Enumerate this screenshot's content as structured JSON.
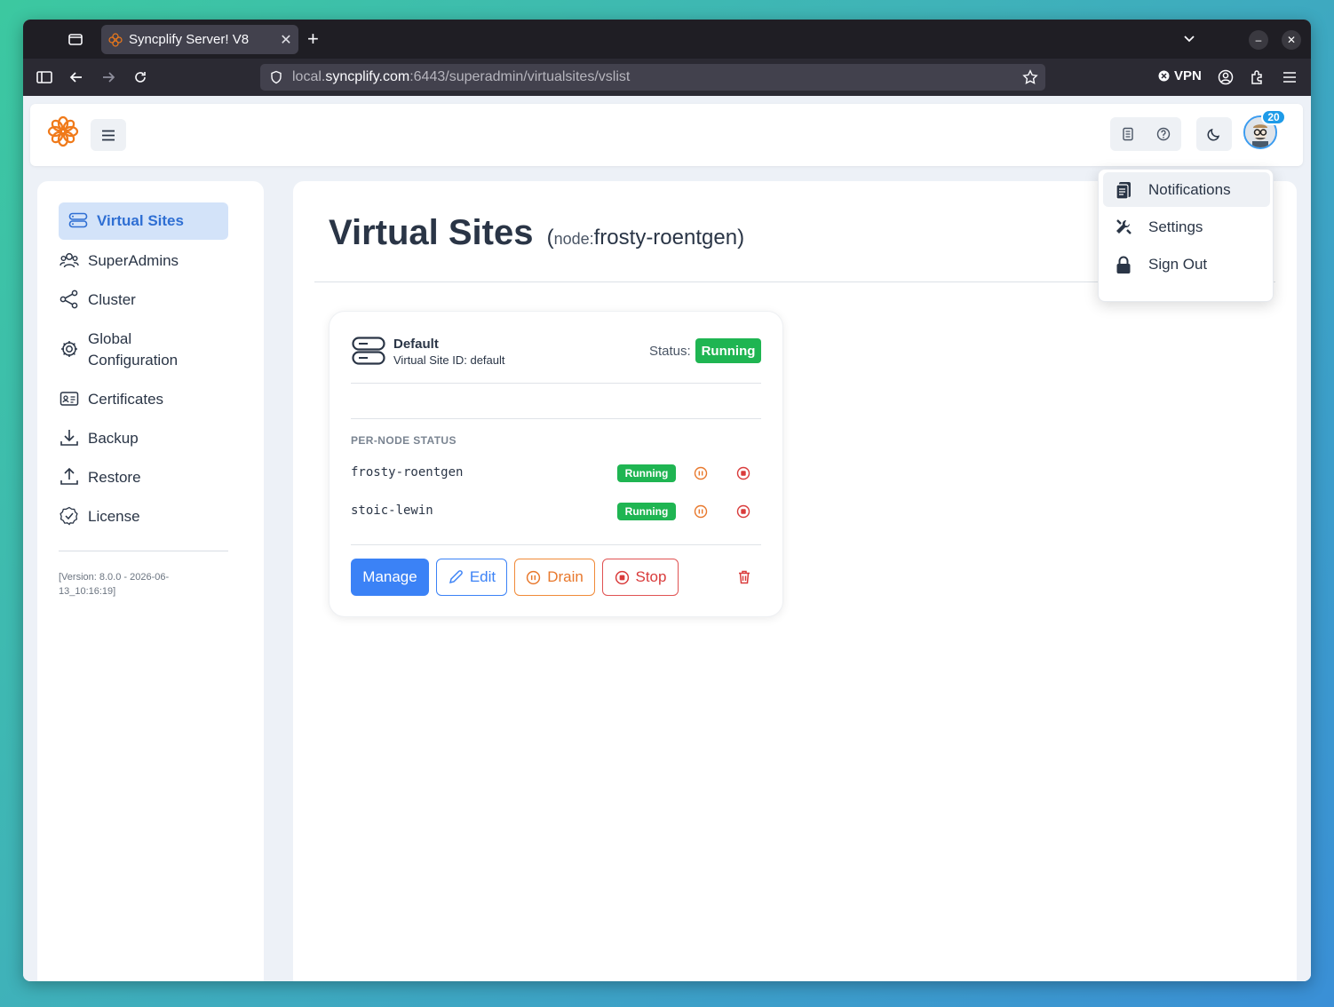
{
  "browser": {
    "tab_title": "Syncplify Server! V8",
    "tab_close": "✕",
    "new_tab": "+",
    "url_prefix": "local.",
    "url_domain": "syncplify.com",
    "url_rest": ":6443/superadmin/virtualsites/vslist",
    "vpn_label": "VPN"
  },
  "header": {
    "notification_count": "20"
  },
  "sidebar": {
    "items": [
      {
        "label": "Virtual Sites",
        "icon": "server-icon"
      },
      {
        "label": "SuperAdmins",
        "icon": "users-icon"
      },
      {
        "label": "Cluster",
        "icon": "share-icon"
      },
      {
        "label": "Global Configuration",
        "icon": "gear-icon"
      },
      {
        "label": "Certificates",
        "icon": "id-card-icon"
      },
      {
        "label": "Backup",
        "icon": "download-icon"
      },
      {
        "label": "Restore",
        "icon": "upload-icon"
      },
      {
        "label": "License",
        "icon": "badge-check-icon"
      }
    ],
    "global_config_line1": "Global",
    "global_config_line2": "Configuration",
    "version": "[Version: 8.0.0 - 2026-06-13_10:16:19]"
  },
  "main": {
    "title": "Virtual Sites",
    "subtitle_open": "(",
    "subtitle_node_kw": "node:",
    "subtitle_node": "frosty-roentgen",
    "subtitle_close": ")"
  },
  "card": {
    "name": "Default",
    "id_text": "Virtual Site ID: default",
    "status_label": "Status:",
    "status": "Running",
    "per_node_header": "PER-NODE STATUS",
    "nodes": [
      {
        "name": "frosty-roentgen",
        "status": "Running"
      },
      {
        "name": "stoic-lewin",
        "status": "Running"
      }
    ],
    "buttons": {
      "manage": "Manage",
      "edit": "Edit",
      "drain": "Drain",
      "stop": "Stop"
    }
  },
  "user_menu": {
    "items": [
      {
        "label": "Notifications",
        "icon": "clipboard-icon"
      },
      {
        "label": "Settings",
        "icon": "tools-icon"
      },
      {
        "label": "Sign Out",
        "icon": "lock-icon"
      }
    ]
  },
  "colors": {
    "accent": "#3b82f6",
    "running": "#1fb552",
    "drain": "#e8782c",
    "stop": "#d93b3b",
    "brand": "#f07a1a"
  }
}
